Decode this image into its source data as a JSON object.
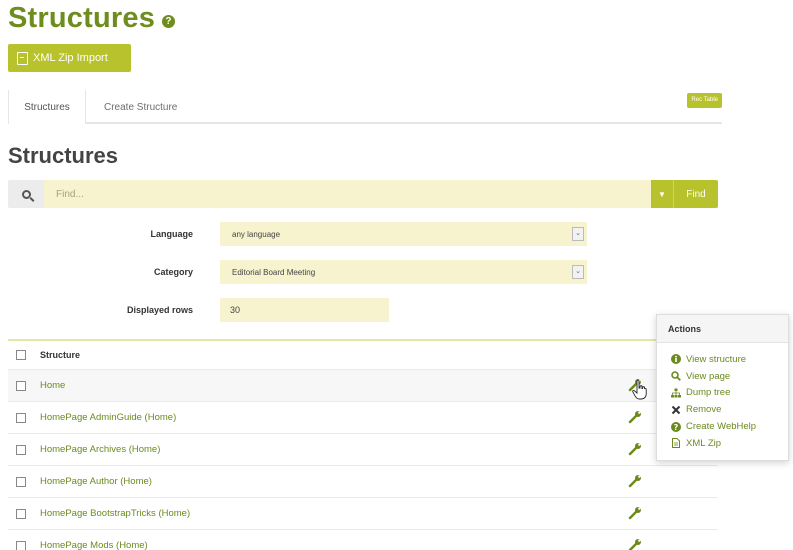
{
  "page": {
    "title": "Structures",
    "import_button": "XML Zip Import"
  },
  "tabs": {
    "structures": "Structures",
    "create": "Create Structure",
    "badge": "Rec Table"
  },
  "section": {
    "title": "Structures"
  },
  "search": {
    "placeholder": "Find...",
    "find_button": "Find"
  },
  "filters": {
    "language_label": "Language",
    "language_value": "any language",
    "category_label": "Category",
    "category_value": "Editorial Board Meeting",
    "rows_label": "Displayed rows",
    "rows_value": "30"
  },
  "table": {
    "header": "Structure",
    "rows": [
      "Home",
      "HomePage AdminGuide (Home)",
      "HomePage Archives (Home)",
      "HomePage Author (Home)",
      "HomePage BootstrapTricks (Home)",
      "HomePage Mods (Home)"
    ]
  },
  "actions": {
    "title": "Actions",
    "items": [
      {
        "label": "View structure",
        "icon": "info-icon"
      },
      {
        "label": "View page",
        "icon": "zoom-icon"
      },
      {
        "label": "Dump tree",
        "icon": "sitemap-icon"
      },
      {
        "label": "Remove",
        "icon": "close-icon"
      },
      {
        "label": "Create WebHelp",
        "icon": "help-icon"
      },
      {
        "label": "XML Zip",
        "icon": "file-icon"
      }
    ]
  },
  "colors": {
    "accent": "#b8c22c",
    "link": "#6b8a1d",
    "title": "#6f8d1e",
    "input_bg": "#f7f3cf"
  }
}
